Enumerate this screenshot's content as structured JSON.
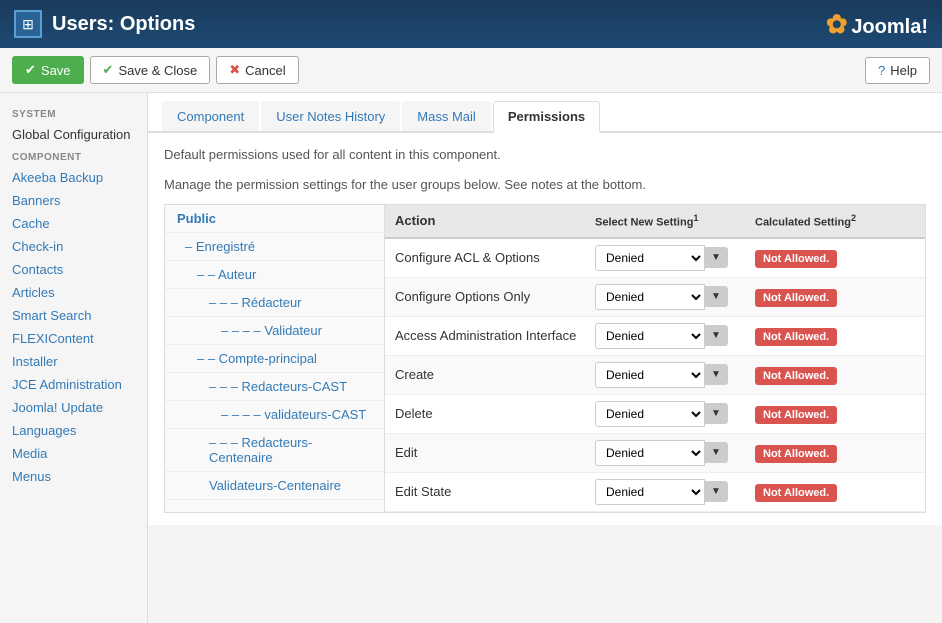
{
  "header": {
    "icon": "⊞",
    "title": "Users: Options",
    "joomla_logo": "Joomla!"
  },
  "toolbar": {
    "save_label": "Save",
    "save_close_label": "Save & Close",
    "cancel_label": "Cancel",
    "help_label": "Help"
  },
  "sidebar": {
    "sections": [
      {
        "title": "SYSTEM",
        "items": [
          {
            "label": "Global Configuration",
            "type": "text-only"
          }
        ]
      },
      {
        "title": "COMPONENT",
        "items": [
          {
            "label": "Akeeba Backup",
            "type": "link"
          },
          {
            "label": "Banners",
            "type": "link"
          },
          {
            "label": "Cache",
            "type": "link"
          },
          {
            "label": "Check-in",
            "type": "link"
          },
          {
            "label": "Contacts",
            "type": "link"
          },
          {
            "label": "Articles",
            "type": "link"
          },
          {
            "label": "Smart Search",
            "type": "link"
          },
          {
            "label": "FLEXIContent",
            "type": "link"
          },
          {
            "label": "Installer",
            "type": "link"
          },
          {
            "label": "JCE Administration",
            "type": "link"
          },
          {
            "label": "Joomla! Update",
            "type": "link"
          },
          {
            "label": "Languages",
            "type": "link"
          },
          {
            "label": "Media",
            "type": "link"
          },
          {
            "label": "Menus",
            "type": "link"
          }
        ]
      }
    ]
  },
  "tabs": [
    {
      "label": "Component",
      "active": false
    },
    {
      "label": "User Notes History",
      "active": false
    },
    {
      "label": "Mass Mail",
      "active": false
    },
    {
      "label": "Permissions",
      "active": true
    }
  ],
  "permissions": {
    "description_1": "Default permissions used for all content in this component.",
    "description_2": "Manage the permission settings for the user groups below. See notes at the bottom.",
    "groups": [
      {
        "label": "Public",
        "indent": 0,
        "type": "public"
      },
      {
        "label": "– Enregistré",
        "indent": 1
      },
      {
        "label": "– – Auteur",
        "indent": 2
      },
      {
        "label": "– – – Rédacteur",
        "indent": 3
      },
      {
        "label": "– – – – Validateur",
        "indent": 4
      },
      {
        "label": "– – Compte-principal",
        "indent": 2
      },
      {
        "label": "– – – Redacteurs-CAST",
        "indent": 3
      },
      {
        "label": "– – – – validateurs-CAST",
        "indent": 4
      },
      {
        "label": "– – – Redacteurs-Centenaire",
        "indent": 3
      },
      {
        "label": "Validateurs-Centenaire",
        "indent": 3
      }
    ],
    "table_headers": {
      "action": "Action",
      "select_new_setting": "Select New Setting",
      "select_new_setting_sup": "1",
      "calculated_setting": "Calculated Setting",
      "calculated_setting_sup": "2"
    },
    "actions": [
      {
        "name": "Configure ACL & Options",
        "setting": "Denied",
        "calculated": "Not Allowed."
      },
      {
        "name": "Configure Options Only",
        "setting": "Denied",
        "calculated": "Not Allowed."
      },
      {
        "name": "Access Administration Interface",
        "setting": "Denied",
        "calculated": "Not Allowed."
      },
      {
        "name": "Create",
        "setting": "Denied",
        "calculated": "Not Allowed."
      },
      {
        "name": "Delete",
        "setting": "Denied",
        "calculated": "Not Allowed."
      },
      {
        "name": "Edit",
        "setting": "Denied",
        "calculated": "Not Allowed."
      },
      {
        "name": "Edit State",
        "setting": "Denied",
        "calculated": "Not Allowed."
      }
    ]
  }
}
